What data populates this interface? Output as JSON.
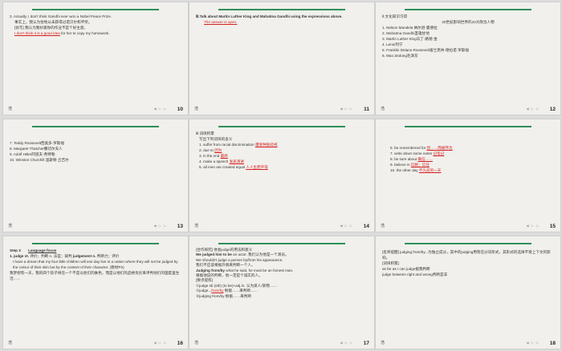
{
  "logo": "浩",
  "nav": "◀ ▷ ▷",
  "s10": {
    "number": "10",
    "l1": "3.  Actually, I don't think Gandhi ever won a Nobel Peace Prize.",
    "l2": "事实上，我认为甘地从未获得过诺贝尔和平奖。",
    "l3": "[仿写]  我认为我抄袭你的作业不是个好主意。",
    "l4_red": "I don't think it is a good idea",
    "l4_rest": "for  her to copy my homework."
  },
  "s11": {
    "number": "11",
    "title": "Ⅲ.Talk about Martin Luther King and Mahatma Gandhi using the expressions above.",
    "answer": "The answer is open."
  },
  "s12": {
    "number": "12",
    "heading": "Ⅱ.文化知识习得",
    "subtitle": "20世纪影响世界的10大政治人物",
    "items": [
      "1.  Nelson Mandela 纳尔逊·曼德拉",
      "2.  Mohatma Gandhi圣雄甘地",
      "3.  Martin Luther King马丁·路德·金",
      "4.  Lenin列宁",
      "5.  Franklin Delano Roosevelt富兰克林·德拉诺·罗斯福",
      "6.  Mao Zedong毛泽东"
    ]
  },
  "s13": {
    "number": "13",
    "items": [
      "7.  Teddy Roosevelt西奥多·罗斯福",
      "8.  Margaret Thatcher撒切尔夫人",
      "9.  Adolf Hitler阿道夫·希特勒",
      "10.  Winston Churchill 温斯顿·丘吉尔"
    ]
  },
  "s14": {
    "number": "14",
    "heading": "Ⅲ.词块积累",
    "subtitle": "写出下列词块的含义",
    "items": [
      {
        "n": "1.",
        "text": "suffer  from racial discrimination",
        "ans": "遭受种族歧视"
      },
      {
        "n": "2.",
        "text": "due to",
        "ans": "因为"
      },
      {
        "n": "3.",
        "text": "in the end",
        "ans": "最终"
      },
      {
        "n": "4.",
        "text": "make a speech",
        "ans": "发表演讲"
      },
      {
        "n": "5.",
        "text": "all men are created  equal",
        "ans": "人人生而平等"
      }
    ]
  },
  "s15": {
    "number": "15",
    "items": [
      {
        "n": "6.",
        "text": "be remembered for",
        "ans": "因……而被怀念"
      },
      {
        "n": "7.",
        "text": "write down some notes",
        "ans": "记笔记"
      },
      {
        "n": "8.",
        "text": "be sure about",
        "ans": "确信……"
      },
      {
        "n": "9.",
        "text": "believe in",
        "ans": "信赖；信任"
      },
      {
        "n": "10.",
        "text": "the other day",
        "ans": "不久前的一天"
      }
    ]
  },
  "s16": {
    "number": "16",
    "step": "Step 3",
    "focus": "Language focus",
    "entry_a": "1.  judge vt.",
    "entry_b": "评价；判断   n.  法官；裁判",
    "entry_c": "judgement n.",
    "entry_d": "判断力；评价",
    "p1": "I have a dream that my four little children will one day live in a nation where they will not be judged by the colour of their skin but by the content of their character. (教材P2)",
    "p2": "我梦想有一天，我的四个孩子将在一个不是以他们的肤色，而是以他们的品格优劣来评判他们的国度里生活……"
  },
  "s17": {
    "number": "17",
    "l1": "[合作探究]   体会judge的用法和意义",
    "l2a": "We judged him to be",
    "l2b": " an actor. 我们认为他是一个演员。",
    "l3a": "We shouldn't judge a person by/from",
    "l3b": " his appearance.",
    "l4": "我们不应该根据外貌来判断一个人。",
    "l5a": "Judging from/by",
    "l5b": " what he said, he must be an honest man.",
    "l6": "根据他说的判断，他一定是个诚实的人。",
    "l7": "[要点提炼]",
    "l8": "①judge sb (sth) (to be)+adj./n.   认为某人/某物……",
    "l9a": "②judge...",
    "l9b": "from/by",
    "l9c": " 根据……来判断……",
    "l10": "③judging from/by   根据……来判断"
  },
  "s18": {
    "number": "18",
    "p1": "[名师提醒]   judging  from/by...为独立成分，其中的judging用现在分词形式，其形式的选择不受上下文的影响。",
    "p2": "[词块积累]",
    "p3": "as far as I can judge据我判断",
    "p4": "judge between right and wrong判断是非"
  }
}
